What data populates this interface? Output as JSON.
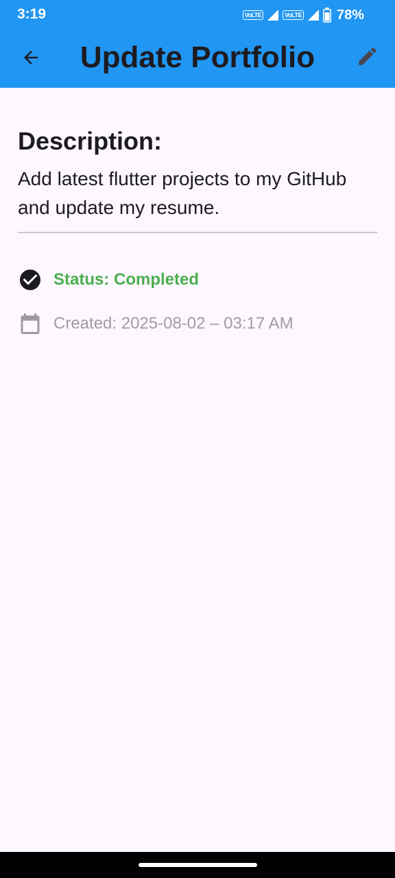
{
  "status_bar": {
    "time": "3:19",
    "volte_1": "VoLTE",
    "volte_2": "VoLTE",
    "battery_percent": "78%"
  },
  "app_bar": {
    "title": "Update Portfolio",
    "back_icon": "arrow-back-icon",
    "edit_icon": "pencil-edit-icon",
    "background_color": "#2196F3"
  },
  "task": {
    "description_heading": "Description:",
    "description": "Add latest flutter projects to my GitHub and update my resume.",
    "status_text": "Status: Completed",
    "status_color": "#4CAF50",
    "status_icon": "check-circle-icon",
    "created_text": "Created: 2025-08-02 – 03:17 AM",
    "created_icon": "calendar-icon"
  }
}
